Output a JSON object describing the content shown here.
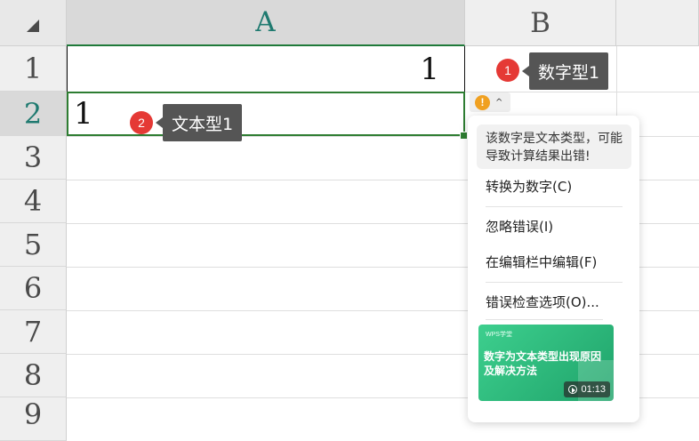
{
  "columns": [
    {
      "label": "A"
    },
    {
      "label": "B"
    }
  ],
  "rows": [
    "1",
    "2",
    "3",
    "4",
    "5",
    "6",
    "7",
    "8",
    "9"
  ],
  "cells": {
    "a1": "1",
    "a2": "1"
  },
  "annotations": [
    {
      "number": "1",
      "text": "数字型1"
    },
    {
      "number": "2",
      "text": "文本型1"
    }
  ],
  "warning": {
    "icon": "warning-icon",
    "icon_glyph": "!",
    "caret": "^"
  },
  "menu": {
    "message": "该数字是文本类型，可能导致计算结果出错!",
    "items": [
      {
        "label": "转换为数字(C)"
      },
      {
        "label": "忽略错误(I)"
      },
      {
        "label": "在编辑栏中编辑(F)"
      },
      {
        "label": "错误检查选项(O)..."
      }
    ]
  },
  "video": {
    "brand": "WPS学堂",
    "title": "数字为文本类型出现原因及解决方法",
    "duration": "01:13"
  },
  "colors": {
    "accent_green": "#2e7d32",
    "badge_red": "#e53935",
    "warning_orange": "#f0a020",
    "tag_gray": "#555555"
  }
}
